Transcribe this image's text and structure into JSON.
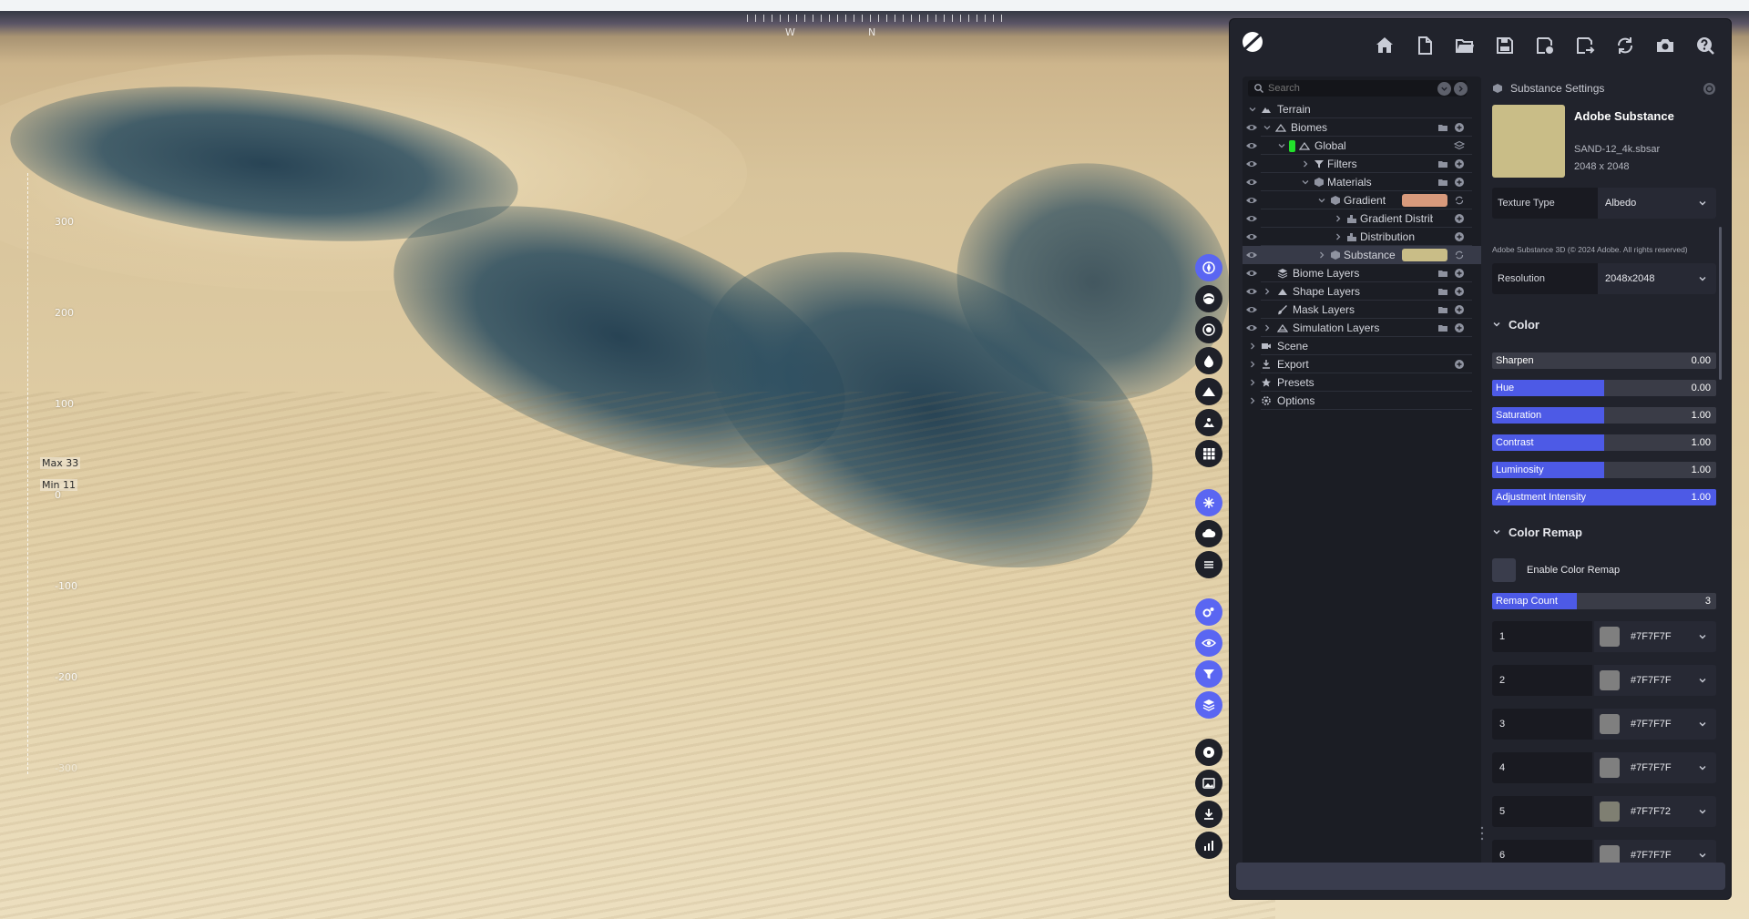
{
  "viewport": {
    "compass": [
      "W",
      "N"
    ],
    "ruler_ticks": [
      "300",
      "200",
      "100",
      "0",
      "-100",
      "-200",
      "-300"
    ],
    "max_label": "Max 33",
    "min_label": "Min 11"
  },
  "toolbar": {
    "buttons": [
      "home-icon",
      "new-file-icon",
      "open-folder-icon",
      "save-icon",
      "save-as-icon",
      "export-icon",
      "refresh-icon",
      "camera-icon",
      "help-icon"
    ]
  },
  "tree": {
    "search_placeholder": "Search",
    "items": {
      "terrain": "Terrain",
      "biomes": "Biomes",
      "global": "Global",
      "filters": "Filters",
      "materials": "Materials",
      "gradient": "Gradient",
      "gradient_distribution": "Gradient Distribution",
      "distribution": "Distribution",
      "substance": "Substance",
      "biome_layers": "Biome Layers",
      "shape_layers": "Shape Layers",
      "mask_layers": "Mask Layers",
      "simulation_layers": "Simulation Layers",
      "scene": "Scene",
      "export": "Export",
      "presets": "Presets",
      "options": "Options"
    },
    "gradient_swatch": "#d89a7c",
    "substance_swatch": "#c9bd87"
  },
  "settings": {
    "header": "Substance Settings",
    "name": "Adobe Substance",
    "file": "SAND-12_4k.sbsar",
    "dims": "2048 x 2048",
    "texture_type_label": "Texture Type",
    "texture_type_value": "Albedo",
    "copyright": "Adobe Substance 3D (© 2024 Adobe. All rights reserved)",
    "resolution_label": "Resolution",
    "resolution_value": "2048x2048",
    "color_section": "Color",
    "sliders": [
      {
        "label": "Sharpen",
        "value": "0.00",
        "fraction": 0.0
      },
      {
        "label": "Hue",
        "value": "0.00",
        "fraction": 0.5
      },
      {
        "label": "Saturation",
        "value": "1.00",
        "fraction": 0.5
      },
      {
        "label": "Contrast",
        "value": "1.00",
        "fraction": 0.5
      },
      {
        "label": "Luminosity",
        "value": "1.00",
        "fraction": 0.5
      },
      {
        "label": "Adjustment Intensity",
        "value": "1.00",
        "fraction": 1.0
      }
    ],
    "remap_section": "Color Remap",
    "enable_remap_label": "Enable Color Remap",
    "remap_count_label": "Remap Count",
    "remap_count_value": "3",
    "remap_count_fraction": 0.38,
    "remap": [
      {
        "index": "1",
        "hex": "#7F7F7F",
        "color": "#7f7f7f"
      },
      {
        "index": "2",
        "hex": "#7F7F7F",
        "color": "#7f7f7f"
      },
      {
        "index": "3",
        "hex": "#7F7F7F",
        "color": "#7f7f7f"
      },
      {
        "index": "4",
        "hex": "#7F7F7F",
        "color": "#7f7f7f"
      },
      {
        "index": "5",
        "hex": "#7F7F72",
        "color": "#7f7f72"
      },
      {
        "index": "6",
        "hex": "#7F7F7F",
        "color": "#7f7f7f"
      }
    ]
  },
  "colors": {
    "accent": "#5a66f2",
    "panel_bg": "#21232c"
  }
}
